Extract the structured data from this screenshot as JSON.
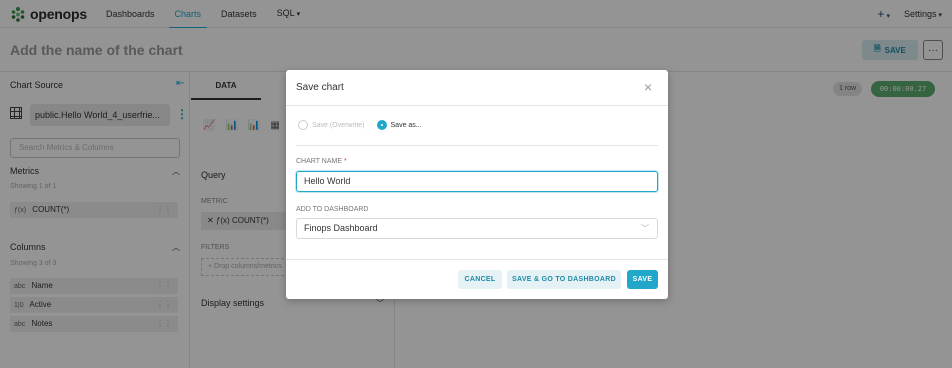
{
  "nav": {
    "brand": "openops",
    "items": [
      "Dashboards",
      "Charts",
      "Datasets",
      "SQL"
    ],
    "plus": "+",
    "settings": "Settings"
  },
  "header": {
    "title": "Add the name of the chart",
    "save_label": "SAVE",
    "more": "···"
  },
  "left": {
    "source_title": "Chart Source",
    "dataset": "public.Hello World_4_userfrie...",
    "search_placeholder": "Search Metrics & Columns",
    "metrics_title": "Metrics",
    "metrics_showing": "Showing 1 of 1",
    "metrics": [
      {
        "type": "ƒ(x)",
        "label": "COUNT(*)"
      }
    ],
    "columns_title": "Columns",
    "columns_showing": "Showing 3 of 3",
    "columns": [
      {
        "type": "abc",
        "label": "Name"
      },
      {
        "type": "1|0",
        "label": "Active"
      },
      {
        "type": "abc",
        "label": "Notes"
      }
    ]
  },
  "mid": {
    "tab": "DATA",
    "query": "Query",
    "metric_label": "METRIC",
    "metric_chip": "ƒ(x) COUNT(*)",
    "filters_label": "FILTERS",
    "drop_text": "+ Drop columns/metrics",
    "display_settings": "Display settings"
  },
  "status": {
    "rows": "1 row",
    "timer": "00:00:00.27"
  },
  "modal": {
    "title": "Save chart",
    "close": "×",
    "radio_overwrite": "Save (Overwrite)",
    "radio_save_as": "Save as...",
    "chart_name_label": "CHART NAME",
    "required_mark": "*",
    "chart_name_value": "Hello World",
    "dashboard_label": "ADD TO DASHBOARD",
    "dashboard_value": "Finops Dashboard",
    "cancel": "CANCEL",
    "save_goto": "SAVE & GO TO DASHBOARD",
    "save": "SAVE"
  },
  "colors": {
    "accent": "#20a7c9",
    "timer_green": "#5cac6e"
  }
}
